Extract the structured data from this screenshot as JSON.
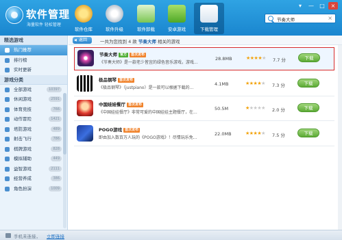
{
  "header": {
    "title": "软件管理",
    "subtitle": "海量软件 轻松管理",
    "nav": [
      {
        "label": "软件仓库",
        "icon": "software-store-icon",
        "active": false
      },
      {
        "label": "软件升级",
        "icon": "software-upgrade-icon",
        "active": false
      },
      {
        "label": "软件卸载",
        "icon": "software-uninstall-icon",
        "active": false
      },
      {
        "label": "安卓游戏",
        "icon": "android-games-icon",
        "active": false
      },
      {
        "label": "下载管理",
        "icon": "download-manager-icon",
        "active": true
      }
    ],
    "search": {
      "value": "节奏大师",
      "clear": "×"
    },
    "window_buttons": [
      "▾",
      "—",
      "□",
      "×"
    ]
  },
  "sidebar": {
    "section1_title": "精选游戏",
    "section1_items": [
      {
        "label": "热门推荐",
        "selected": true
      },
      {
        "label": "排行榜",
        "selected": false
      },
      {
        "label": "实时更新",
        "selected": false
      }
    ],
    "section2_title": "游戏分类",
    "section2_items": [
      {
        "label": "全部游戏",
        "count": "10397"
      },
      {
        "label": "休闲游戏",
        "count": "2591"
      },
      {
        "label": "体育竞技",
        "count": "766"
      },
      {
        "label": "动作冒险",
        "count": "1421"
      },
      {
        "label": "塔防游戏",
        "count": "489"
      },
      {
        "label": "射击飞行",
        "count": "786"
      },
      {
        "label": "棋牌游戏",
        "count": "828"
      },
      {
        "label": "模拟辅助",
        "count": "449"
      },
      {
        "label": "益智游戏",
        "count": "2111"
      },
      {
        "label": "经营养成",
        "count": "386"
      },
      {
        "label": "角色扮演",
        "count": "1009"
      }
    ]
  },
  "main": {
    "back_label": "返回",
    "result": {
      "prefix": "一共为您找到 4 款",
      "keyword": "节奏大师",
      "suffix": "相关的游戏"
    },
    "apps": [
      {
        "name": "节奏大师",
        "tags": [
          {
            "text": "官方",
            "color": "green"
          },
          {
            "text": "首次发布",
            "color": "orange"
          }
        ],
        "desc": "《节奏大师》是一款老少皆宜的绿色音乐游戏，游戏...",
        "size": "28.8MB",
        "stars": 4,
        "score": "7.7 分",
        "button": "下载",
        "highlight": true
      },
      {
        "name": "极品钢琴",
        "tags": [
          {
            "text": "首次发布",
            "color": "orange"
          }
        ],
        "desc": "《极品钢琴》（justpiano）是一款可以根据下载的...",
        "size": "4.1MB",
        "stars": 4,
        "score": "7.3 分",
        "button": "下载",
        "highlight": false
      },
      {
        "name": "中国娃娃餐厅",
        "tags": [
          {
            "text": "首次发布",
            "color": "orange"
          }
        ],
        "desc": "《中国娃娃餐厅》非常可爱的中国娃娃主题餐厅，在...",
        "size": "50.5M",
        "stars": 1,
        "score": "2.0 分",
        "button": "下载",
        "highlight": false
      },
      {
        "name": "POGO游戏",
        "tags": [
          {
            "text": "首次发布",
            "color": "orange"
          }
        ],
        "desc": "即由加入数百万人玩的《POGO游戏》！尽情玩乐免...",
        "size": "22.0MB",
        "stars": 4,
        "score": "7.5 分",
        "button": "下载",
        "highlight": false
      }
    ]
  },
  "status": {
    "text": "手机未连接，",
    "link": "立即连接"
  },
  "colors": {
    "header": "#1a86cf",
    "highlight_border": "#d72a2a",
    "download_button": "#5caa35",
    "tag_official": "#4fae35",
    "tag_first": "#f0832c",
    "star": "#f2a20a"
  }
}
